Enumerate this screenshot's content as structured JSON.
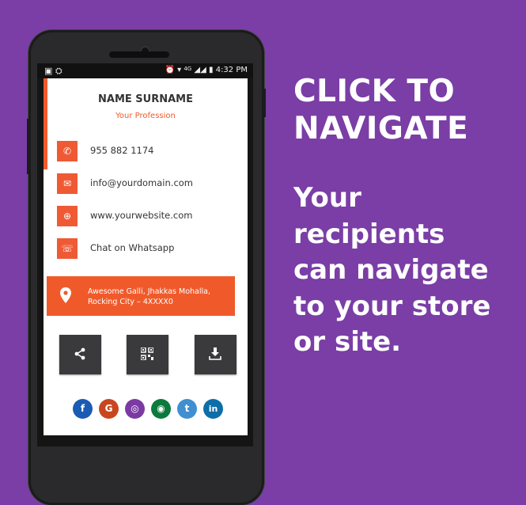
{
  "statusbar": {
    "left_icons": "▣ ⛭",
    "network": "4G",
    "time": "4:32 PM"
  },
  "card": {
    "name": "NAME SURNAME",
    "profession": "Your Profession",
    "contacts": [
      {
        "icon": "phone-icon",
        "text": "955 882 1174"
      },
      {
        "icon": "mail-icon",
        "text": "info@yourdomain.com"
      },
      {
        "icon": "globe-icon",
        "text": "www.yourwebsite.com"
      },
      {
        "icon": "whatsapp-icon",
        "text": "Chat on Whatsapp"
      }
    ],
    "address_line1": "Awesome Galli, Jhakkas Mohalla,",
    "address_line2": "Rocking City – 4XXXX0",
    "actions": [
      "share-icon",
      "qr-code-icon",
      "download-icon"
    ],
    "social": [
      {
        "label": "f",
        "icon": "facebook-icon",
        "color": "#1a5bb5"
      },
      {
        "label": "G",
        "icon": "google-icon",
        "color": "#c8471e"
      },
      {
        "label": "◎",
        "icon": "instagram-icon",
        "color": "#7b3aa3"
      },
      {
        "label": "◉",
        "icon": "maps-icon",
        "color": "#0b7a3c"
      },
      {
        "label": "t",
        "icon": "twitter-icon",
        "color": "#3f8fd1"
      },
      {
        "label": "in",
        "icon": "linkedin-icon",
        "color": "#0d6ea8"
      }
    ]
  },
  "promo": {
    "headline_line1": "CLICK TO",
    "headline_line2": "NAVIGATE",
    "sub_line1": "Your",
    "sub_line2": "recipients",
    "sub_line3": "can navigate",
    "sub_line4": "to your store",
    "sub_line5": "or site."
  },
  "colors": {
    "background": "#7a3ea6",
    "accent": "#f05a2b",
    "action_button": "#3a3a3c"
  }
}
